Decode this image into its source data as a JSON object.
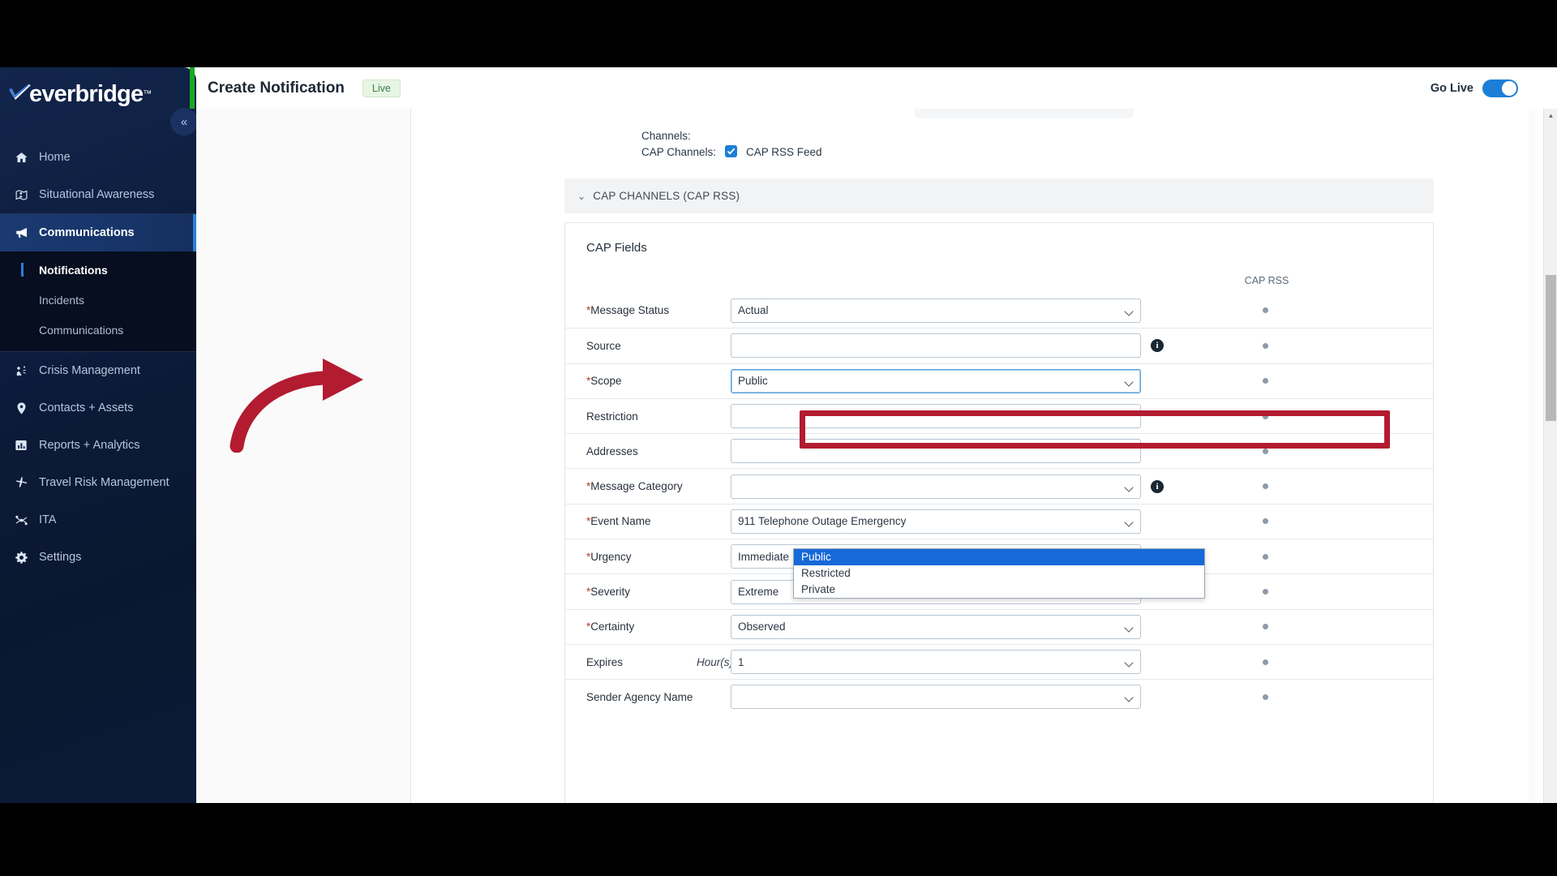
{
  "brand": {
    "name": "everbridge",
    "tm": "™"
  },
  "header": {
    "title": "Create Notification",
    "badge": "Live",
    "go_live_label": "Go Live",
    "toggle_state": "on",
    "accent_green": "#17ab1f",
    "toggle_color": "#1c7ed6"
  },
  "sidebar": {
    "collapse_icon": "«",
    "items": [
      {
        "label": "Home",
        "icon": "home-icon",
        "active": false
      },
      {
        "label": "Situational Awareness",
        "icon": "map-pin-person-icon",
        "active": false
      },
      {
        "label": "Communications",
        "icon": "megaphone-icon",
        "active": true
      },
      {
        "label": "Crisis Management",
        "icon": "crisis-people-icon",
        "active": false
      },
      {
        "label": "Contacts + Assets",
        "icon": "location-pin-icon",
        "active": false
      },
      {
        "label": "Reports + Analytics",
        "icon": "bar-chart-icon",
        "active": false
      },
      {
        "label": "Travel Risk Management",
        "icon": "airplane-icon",
        "active": false
      },
      {
        "label": "ITA",
        "icon": "network-nodes-icon",
        "active": false
      },
      {
        "label": "Settings",
        "icon": "gear-icon",
        "active": false
      }
    ],
    "subitems": [
      {
        "label": "Notifications",
        "current": true
      },
      {
        "label": "Incidents",
        "current": false
      },
      {
        "label": "Communications",
        "current": false
      }
    ]
  },
  "content": {
    "channels_label": "Channels:",
    "cap_channels_label": "CAP Channels:",
    "cap_rss_feed_label": "CAP RSS Feed",
    "cap_rss_feed_checked": true,
    "accordion_label": "CAP CHANNELS (CAP RSS)",
    "accordion_chevron": "⌄",
    "cap_fields_title": "CAP Fields",
    "cap_rss_column_header": "CAP RSS",
    "rows": [
      {
        "label": "Message Status",
        "required": true,
        "value": "Actual",
        "type": "select",
        "info": false,
        "unit": ""
      },
      {
        "label": "Source",
        "required": false,
        "value": "",
        "type": "text",
        "info": true,
        "unit": ""
      },
      {
        "label": "Scope",
        "required": true,
        "value": "Public",
        "type": "select",
        "info": false,
        "unit": "",
        "highlighted": true
      },
      {
        "label": "Restriction",
        "required": false,
        "value": "",
        "type": "text",
        "info": false,
        "unit": ""
      },
      {
        "label": "Addresses",
        "required": false,
        "value": "",
        "type": "text",
        "info": false,
        "unit": ""
      },
      {
        "label": "Message Category",
        "required": true,
        "value": "",
        "type": "select",
        "info": true,
        "unit": ""
      },
      {
        "label": "Event Name",
        "required": true,
        "value": "911 Telephone Outage Emergency",
        "type": "select",
        "info": false,
        "unit": ""
      },
      {
        "label": "Urgency",
        "required": true,
        "value": "Immediate",
        "type": "select",
        "info": false,
        "unit": ""
      },
      {
        "label": "Severity",
        "required": true,
        "value": "Extreme",
        "type": "select",
        "info": false,
        "unit": ""
      },
      {
        "label": "Certainty",
        "required": true,
        "value": "Observed",
        "type": "select",
        "info": false,
        "unit": ""
      },
      {
        "label": "Expires",
        "required": false,
        "value": "1",
        "type": "select",
        "info": false,
        "unit": "Hour(s)"
      },
      {
        "label": "Sender Agency Name",
        "required": false,
        "value": "",
        "type": "select",
        "info": false,
        "unit": ""
      }
    ],
    "scope_dropdown": {
      "open": true,
      "options": [
        "Public",
        "Restricted",
        "Private"
      ],
      "selected": "Public",
      "selected_bg": "#1669d8"
    },
    "annotation": {
      "highlight_color": "#b31b30",
      "arrow_color": "#b31b30",
      "target": "Scope"
    }
  }
}
